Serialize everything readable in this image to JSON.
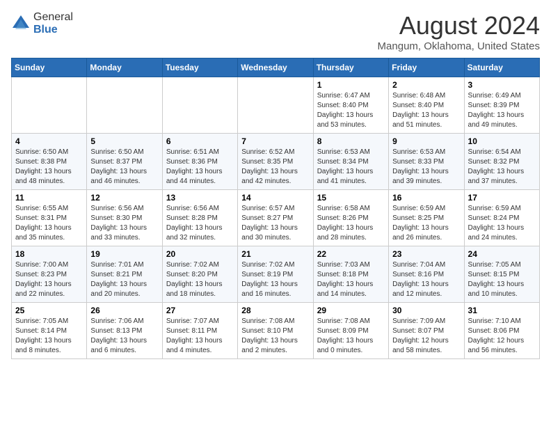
{
  "logo": {
    "general": "General",
    "blue": "Blue"
  },
  "title": "August 2024",
  "location": "Mangum, Oklahoma, United States",
  "days_of_week": [
    "Sunday",
    "Monday",
    "Tuesday",
    "Wednesday",
    "Thursday",
    "Friday",
    "Saturday"
  ],
  "weeks": [
    [
      {
        "day": "",
        "info": ""
      },
      {
        "day": "",
        "info": ""
      },
      {
        "day": "",
        "info": ""
      },
      {
        "day": "",
        "info": ""
      },
      {
        "day": "1",
        "info": "Sunrise: 6:47 AM\nSunset: 8:40 PM\nDaylight: 13 hours\nand 53 minutes."
      },
      {
        "day": "2",
        "info": "Sunrise: 6:48 AM\nSunset: 8:40 PM\nDaylight: 13 hours\nand 51 minutes."
      },
      {
        "day": "3",
        "info": "Sunrise: 6:49 AM\nSunset: 8:39 PM\nDaylight: 13 hours\nand 49 minutes."
      }
    ],
    [
      {
        "day": "4",
        "info": "Sunrise: 6:50 AM\nSunset: 8:38 PM\nDaylight: 13 hours\nand 48 minutes."
      },
      {
        "day": "5",
        "info": "Sunrise: 6:50 AM\nSunset: 8:37 PM\nDaylight: 13 hours\nand 46 minutes."
      },
      {
        "day": "6",
        "info": "Sunrise: 6:51 AM\nSunset: 8:36 PM\nDaylight: 13 hours\nand 44 minutes."
      },
      {
        "day": "7",
        "info": "Sunrise: 6:52 AM\nSunset: 8:35 PM\nDaylight: 13 hours\nand 42 minutes."
      },
      {
        "day": "8",
        "info": "Sunrise: 6:53 AM\nSunset: 8:34 PM\nDaylight: 13 hours\nand 41 minutes."
      },
      {
        "day": "9",
        "info": "Sunrise: 6:53 AM\nSunset: 8:33 PM\nDaylight: 13 hours\nand 39 minutes."
      },
      {
        "day": "10",
        "info": "Sunrise: 6:54 AM\nSunset: 8:32 PM\nDaylight: 13 hours\nand 37 minutes."
      }
    ],
    [
      {
        "day": "11",
        "info": "Sunrise: 6:55 AM\nSunset: 8:31 PM\nDaylight: 13 hours\nand 35 minutes."
      },
      {
        "day": "12",
        "info": "Sunrise: 6:56 AM\nSunset: 8:30 PM\nDaylight: 13 hours\nand 33 minutes."
      },
      {
        "day": "13",
        "info": "Sunrise: 6:56 AM\nSunset: 8:28 PM\nDaylight: 13 hours\nand 32 minutes."
      },
      {
        "day": "14",
        "info": "Sunrise: 6:57 AM\nSunset: 8:27 PM\nDaylight: 13 hours\nand 30 minutes."
      },
      {
        "day": "15",
        "info": "Sunrise: 6:58 AM\nSunset: 8:26 PM\nDaylight: 13 hours\nand 28 minutes."
      },
      {
        "day": "16",
        "info": "Sunrise: 6:59 AM\nSunset: 8:25 PM\nDaylight: 13 hours\nand 26 minutes."
      },
      {
        "day": "17",
        "info": "Sunrise: 6:59 AM\nSunset: 8:24 PM\nDaylight: 13 hours\nand 24 minutes."
      }
    ],
    [
      {
        "day": "18",
        "info": "Sunrise: 7:00 AM\nSunset: 8:23 PM\nDaylight: 13 hours\nand 22 minutes."
      },
      {
        "day": "19",
        "info": "Sunrise: 7:01 AM\nSunset: 8:21 PM\nDaylight: 13 hours\nand 20 minutes."
      },
      {
        "day": "20",
        "info": "Sunrise: 7:02 AM\nSunset: 8:20 PM\nDaylight: 13 hours\nand 18 minutes."
      },
      {
        "day": "21",
        "info": "Sunrise: 7:02 AM\nSunset: 8:19 PM\nDaylight: 13 hours\nand 16 minutes."
      },
      {
        "day": "22",
        "info": "Sunrise: 7:03 AM\nSunset: 8:18 PM\nDaylight: 13 hours\nand 14 minutes."
      },
      {
        "day": "23",
        "info": "Sunrise: 7:04 AM\nSunset: 8:16 PM\nDaylight: 13 hours\nand 12 minutes."
      },
      {
        "day": "24",
        "info": "Sunrise: 7:05 AM\nSunset: 8:15 PM\nDaylight: 13 hours\nand 10 minutes."
      }
    ],
    [
      {
        "day": "25",
        "info": "Sunrise: 7:05 AM\nSunset: 8:14 PM\nDaylight: 13 hours\nand 8 minutes."
      },
      {
        "day": "26",
        "info": "Sunrise: 7:06 AM\nSunset: 8:13 PM\nDaylight: 13 hours\nand 6 minutes."
      },
      {
        "day": "27",
        "info": "Sunrise: 7:07 AM\nSunset: 8:11 PM\nDaylight: 13 hours\nand 4 minutes."
      },
      {
        "day": "28",
        "info": "Sunrise: 7:08 AM\nSunset: 8:10 PM\nDaylight: 13 hours\nand 2 minutes."
      },
      {
        "day": "29",
        "info": "Sunrise: 7:08 AM\nSunset: 8:09 PM\nDaylight: 13 hours\nand 0 minutes."
      },
      {
        "day": "30",
        "info": "Sunrise: 7:09 AM\nSunset: 8:07 PM\nDaylight: 12 hours\nand 58 minutes."
      },
      {
        "day": "31",
        "info": "Sunrise: 7:10 AM\nSunset: 8:06 PM\nDaylight: 12 hours\nand 56 minutes."
      }
    ]
  ]
}
